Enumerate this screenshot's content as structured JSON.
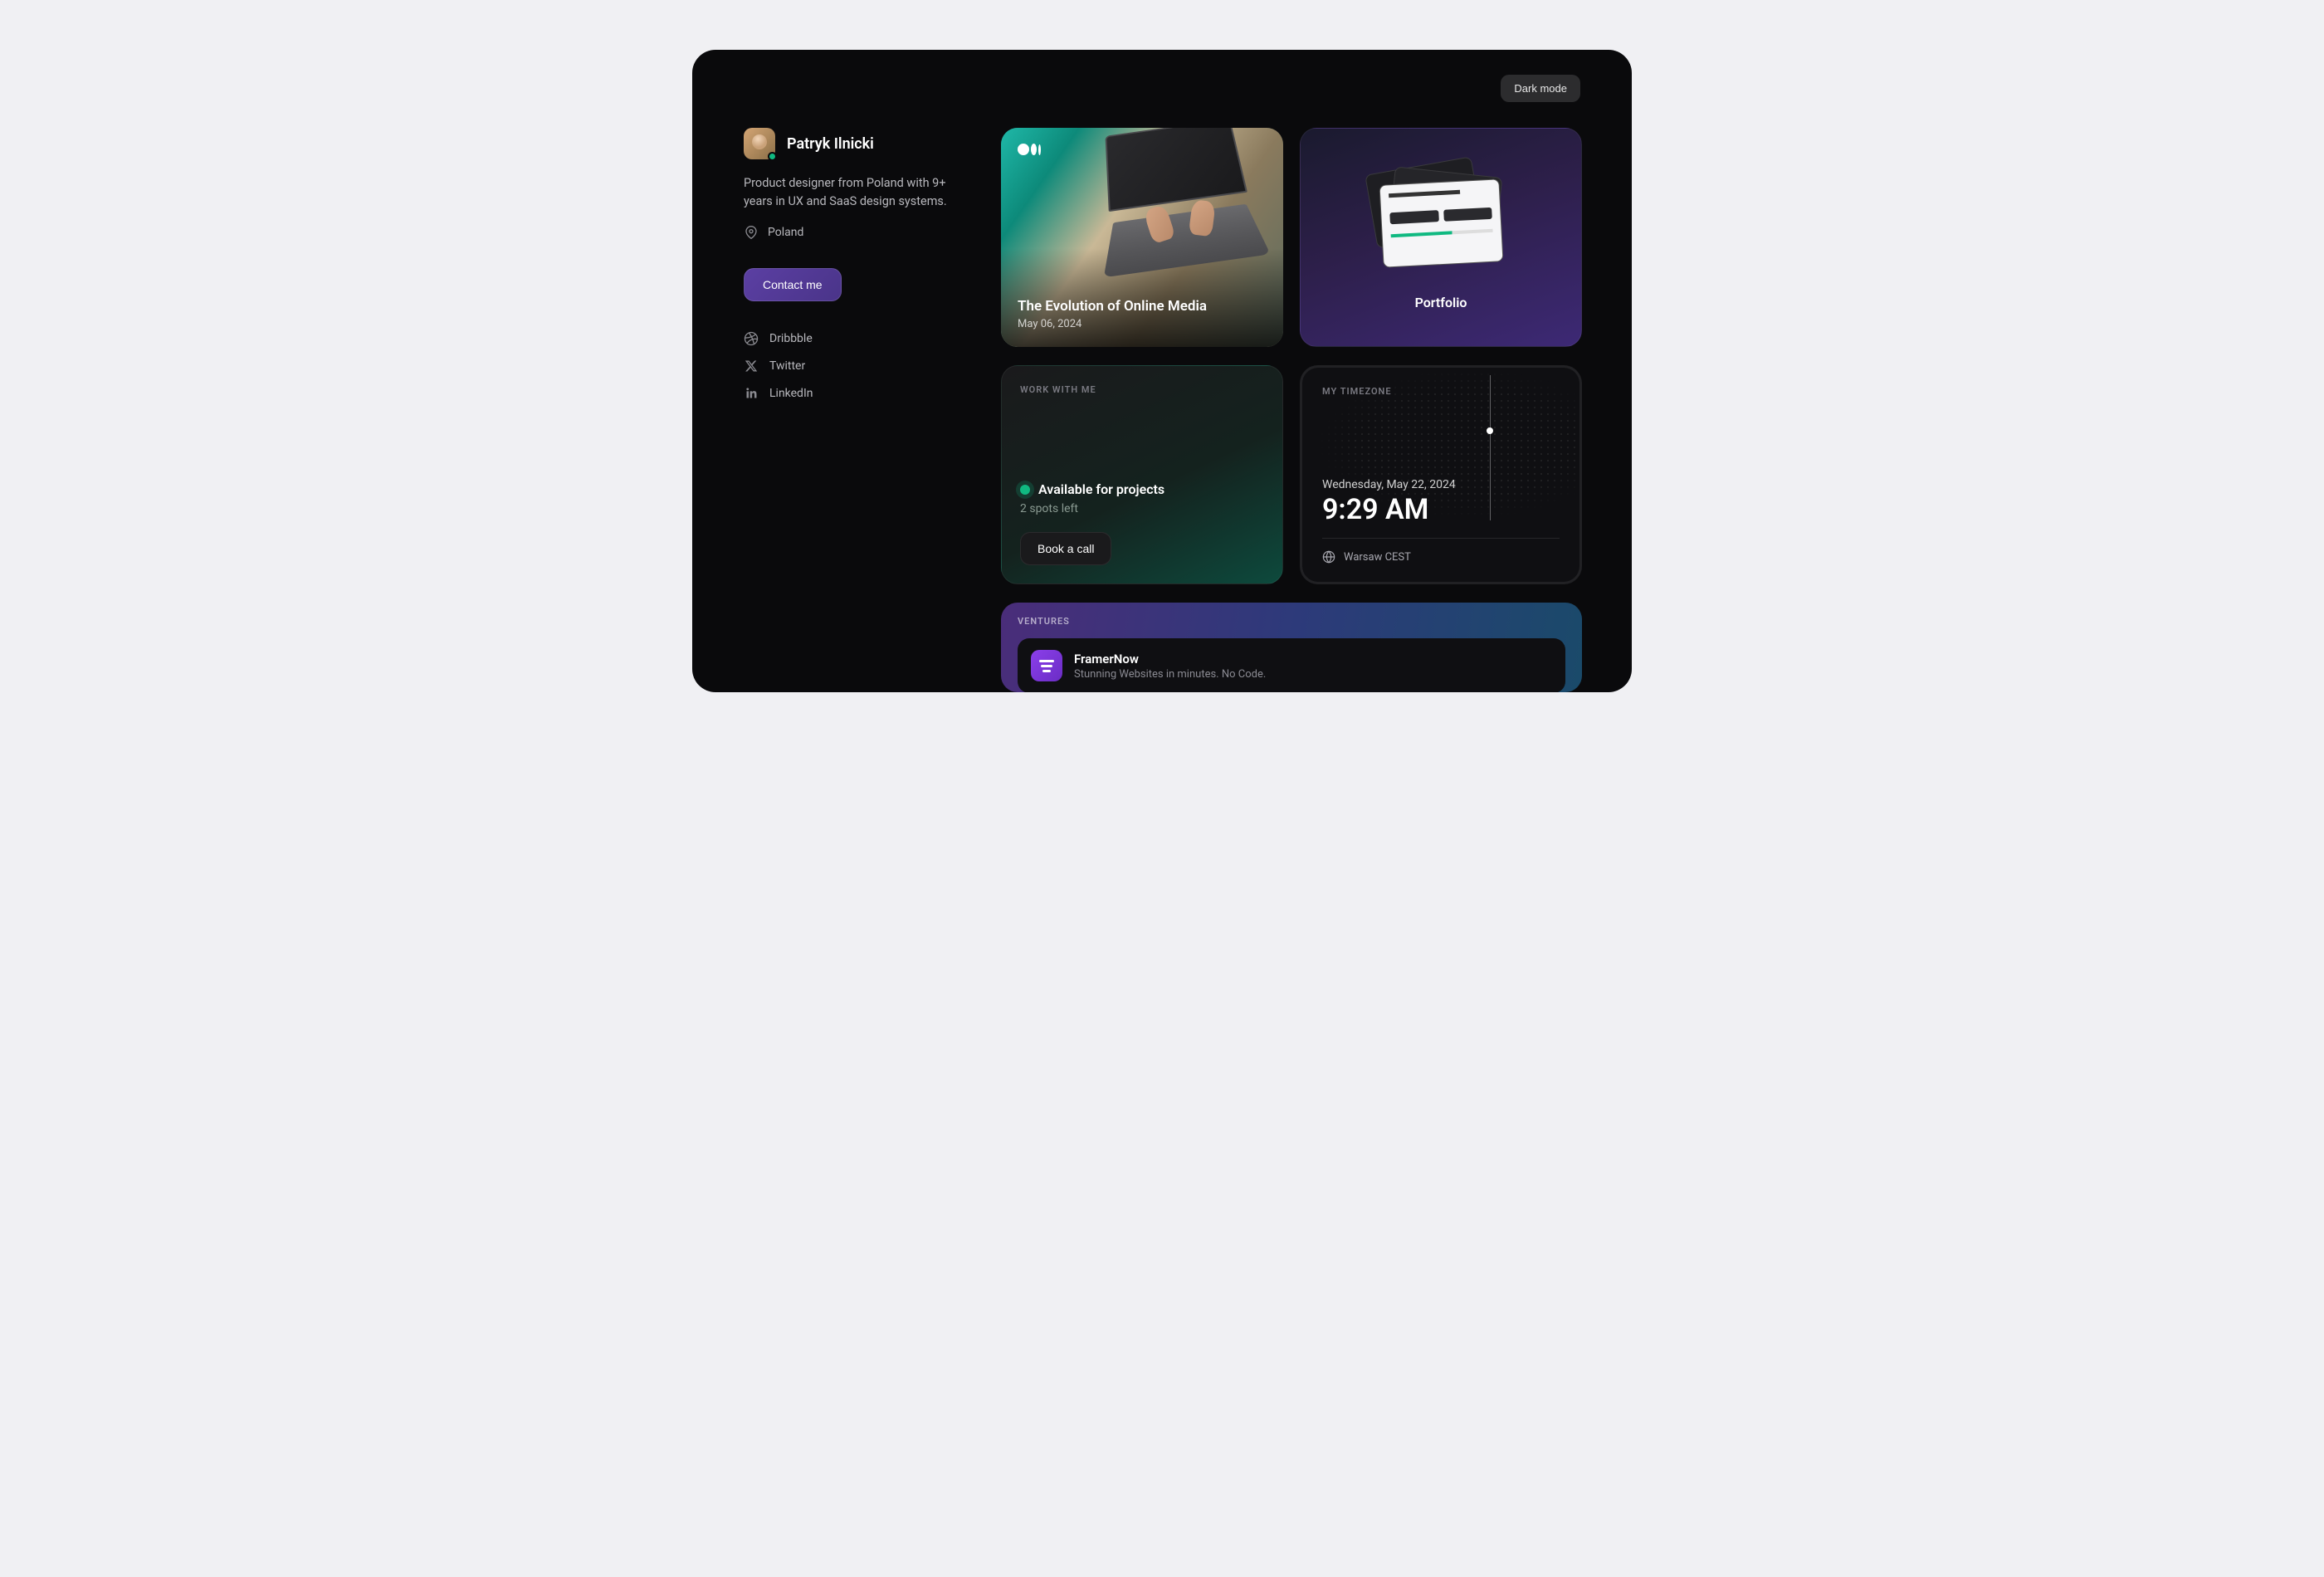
{
  "theme_toggle": "Dark mode",
  "profile": {
    "name": "Patryk Ilnicki",
    "bio": "Product designer from Poland with 9+ years in UX and SaaS design systems.",
    "location": "Poland",
    "contact_label": "Contact me"
  },
  "socials": [
    {
      "name": "Dribbble"
    },
    {
      "name": "Twitter"
    },
    {
      "name": "LinkedIn"
    }
  ],
  "article": {
    "title": "The Evolution of Online Media",
    "date": "May 06, 2024"
  },
  "portfolio": {
    "label": "Portfolio"
  },
  "work": {
    "section_label": "WORK WITH ME",
    "availability": "Available for projects",
    "spots": "2 spots left",
    "cta": "Book a call"
  },
  "timezone": {
    "section_label": "MY TIMEZONE",
    "date": "Wednesday, May 22, 2024",
    "time": "9:29 AM",
    "zone": "Warsaw CEST"
  },
  "ventures": {
    "section_label": "VENTURES",
    "items": [
      {
        "title": "FramerNow",
        "description": "Stunning Websites in minutes. No Code."
      }
    ]
  }
}
